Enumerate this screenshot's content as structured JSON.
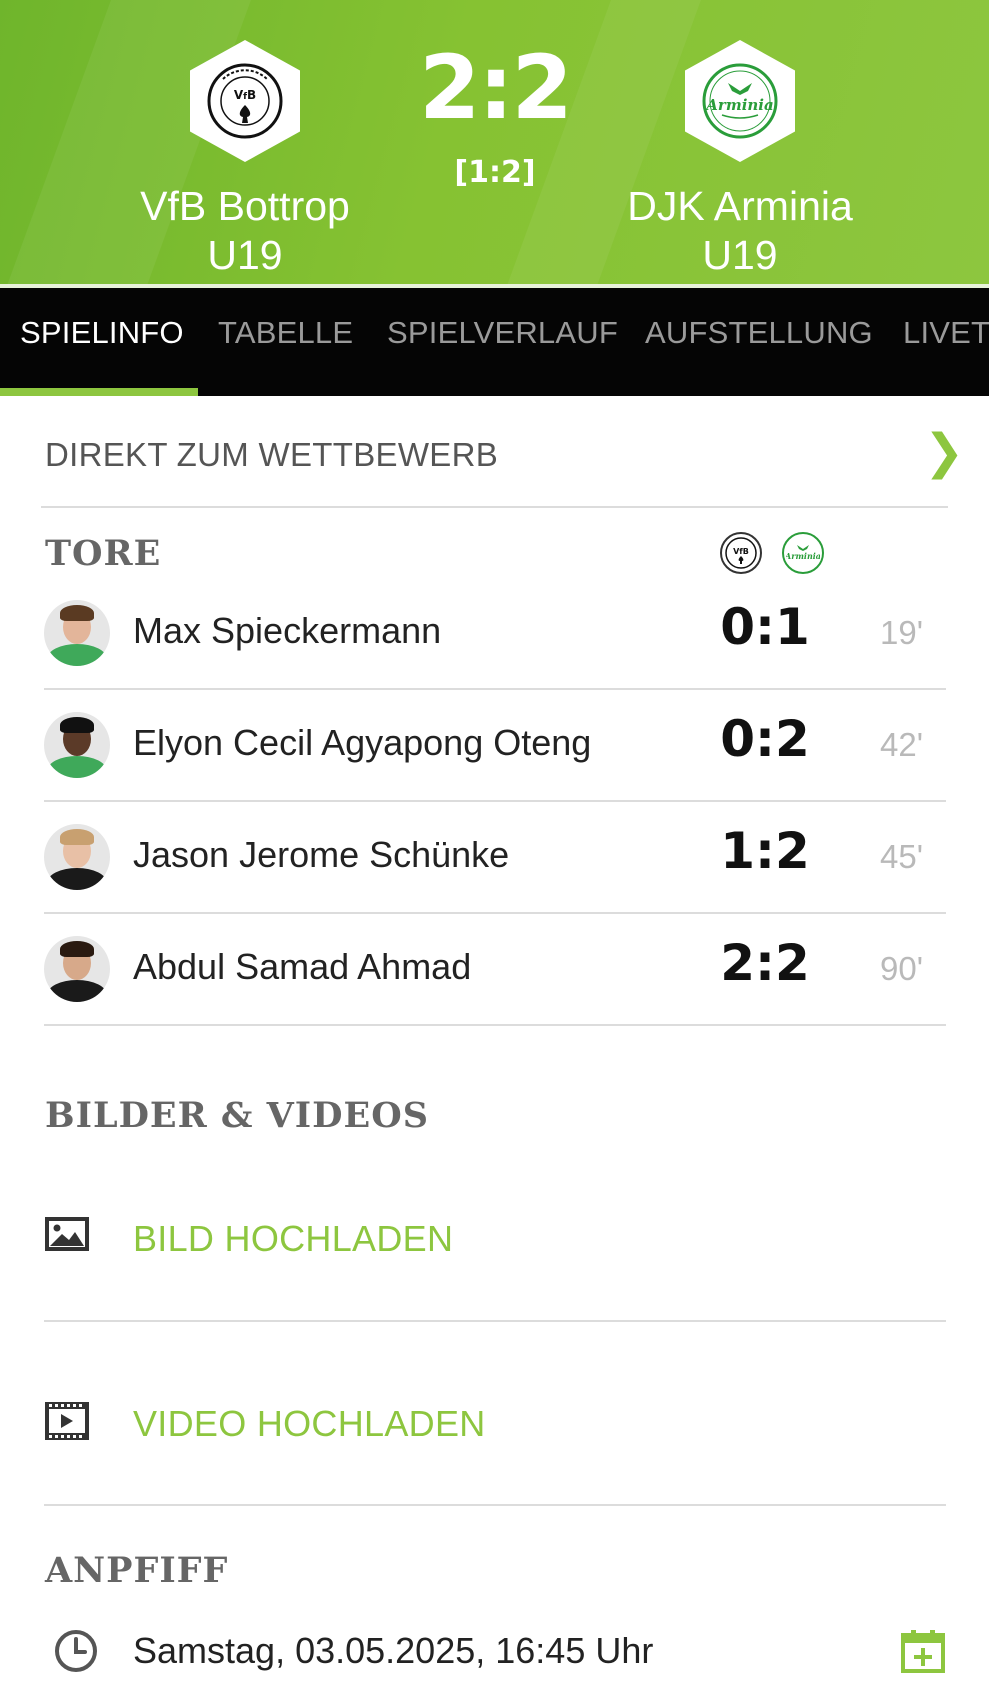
{
  "match": {
    "home_team_line1": "VfB Bottrop",
    "home_team_line2": "U19",
    "away_team_line1": "DJK Arminia",
    "away_team_line2": "U19",
    "score": "2:2",
    "halftime": "[1:2]",
    "home_crest_text": "BOTTROP 1900 VfB",
    "away_crest_text": "Arminia"
  },
  "tabs": [
    {
      "label": "SPIELINFO",
      "active": true
    },
    {
      "label": "TABELLE"
    },
    {
      "label": "SPIELVERLAUF"
    },
    {
      "label": "AUFSTELLUNG"
    },
    {
      "label": "LIVET"
    }
  ],
  "competition_link": {
    "label": "DIREKT ZUM WETTBEWERB",
    "chevron": "❯"
  },
  "goals": {
    "title": "TORE",
    "items": [
      {
        "player": "Max Spieckermann",
        "score": "0:1",
        "minute": "19'"
      },
      {
        "player": "Elyon Cecil Agyapong Oteng",
        "score": "0:2",
        "minute": "42'"
      },
      {
        "player": "Jason Jerome Schünke",
        "score": "1:2",
        "minute": "45'"
      },
      {
        "player": "Abdul Samad Ahmad",
        "score": "2:2",
        "minute": "90'"
      }
    ]
  },
  "media": {
    "title": "BILDER & VIDEOS",
    "upload_image": "BILD HOCHLADEN",
    "upload_video": "VIDEO HOCHLADEN"
  },
  "kickoff": {
    "title": "ANPFIFF",
    "datetime": "Samstag, 03.05.2025, 16:45 Uhr"
  },
  "colors": {
    "accent": "#8dc63f",
    "tab_bar": "#050505",
    "arminia_green": "#2a9d3a"
  },
  "icons": [
    "chevron-right-icon",
    "image-icon",
    "video-icon",
    "clock-icon",
    "calendar-add-icon"
  ]
}
